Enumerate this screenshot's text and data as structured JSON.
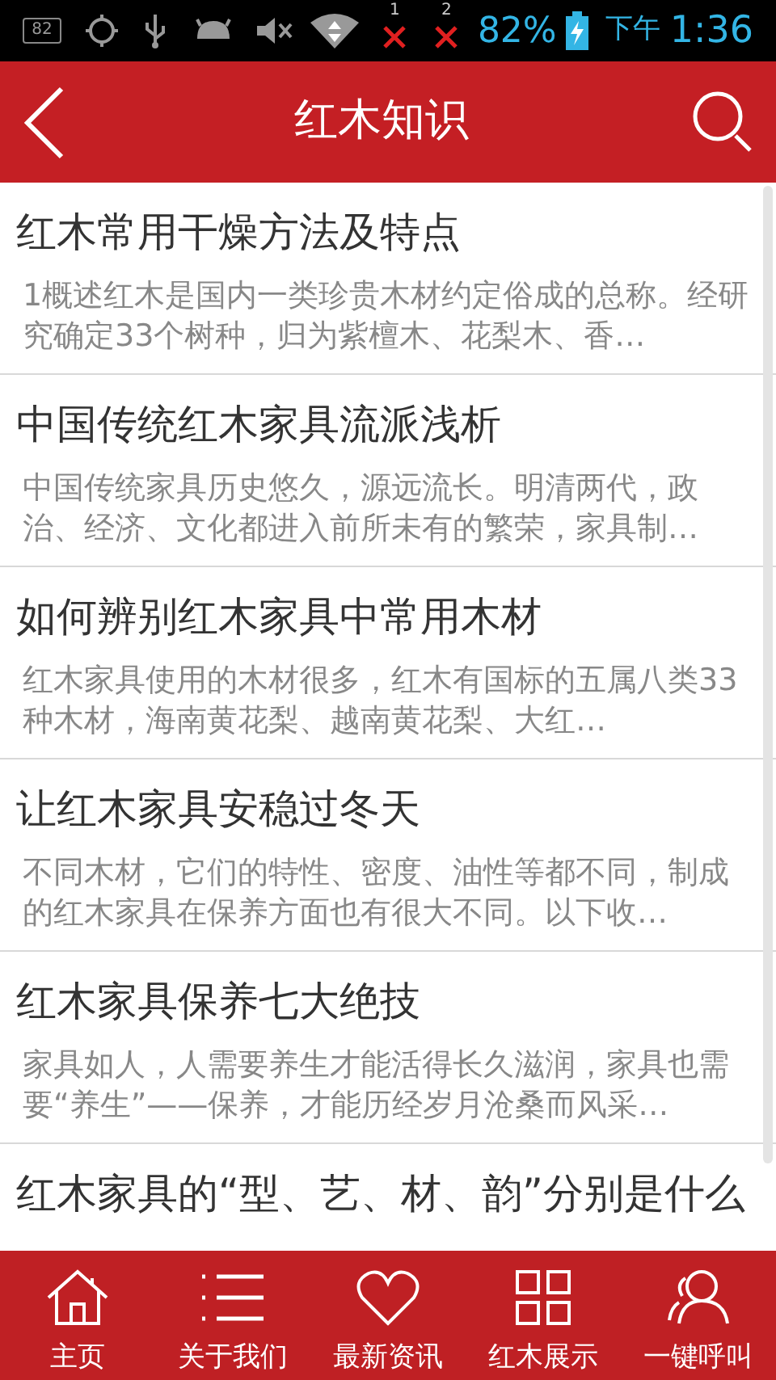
{
  "status_bar": {
    "battery": "82%",
    "period": "下午",
    "time": "1:36",
    "sim_badges": [
      "1",
      "2"
    ],
    "box_label": "82"
  },
  "header": {
    "title": "红木知识"
  },
  "articles": [
    {
      "title": "红木常用干燥方法及特点",
      "summary": "1概述红木是国内一类珍贵木材约定俗成的总称。经研究确定33个树种，归为紫檀木、花梨木、香…"
    },
    {
      "title": "中国传统红木家具流派浅析",
      "summary": "中国传统家具历史悠久，源远流长。明清两代，政治、经济、文化都进入前所未有的繁荣，家具制…"
    },
    {
      "title": "如何辨别红木家具中常用木材",
      "summary": "红木家具使用的木材很多，红木有国标的五属八类33种木材，海南黄花梨、越南黄花梨、大红…"
    },
    {
      "title": "让红木家具安稳过冬天",
      "summary": "不同木材，它们的特性、密度、油性等都不同，制成的红木家具在保养方面也有很大不同。以下收…"
    },
    {
      "title": "红木家具保养七大绝技",
      "summary": "家具如人，人需要养生才能活得长久滋润，家具也需要“养生”——保养，才能历经岁月沧桑而风采…"
    },
    {
      "title": "红木家具的“型、艺、材、韵”分别是什么"
    }
  ],
  "nav": [
    {
      "kind": "home",
      "label": "主页"
    },
    {
      "kind": "list",
      "label": "关于我们"
    },
    {
      "kind": "heart",
      "label": "最新资讯"
    },
    {
      "kind": "grid",
      "label": "红木展示"
    },
    {
      "kind": "people",
      "label": "一键呼叫"
    }
  ]
}
